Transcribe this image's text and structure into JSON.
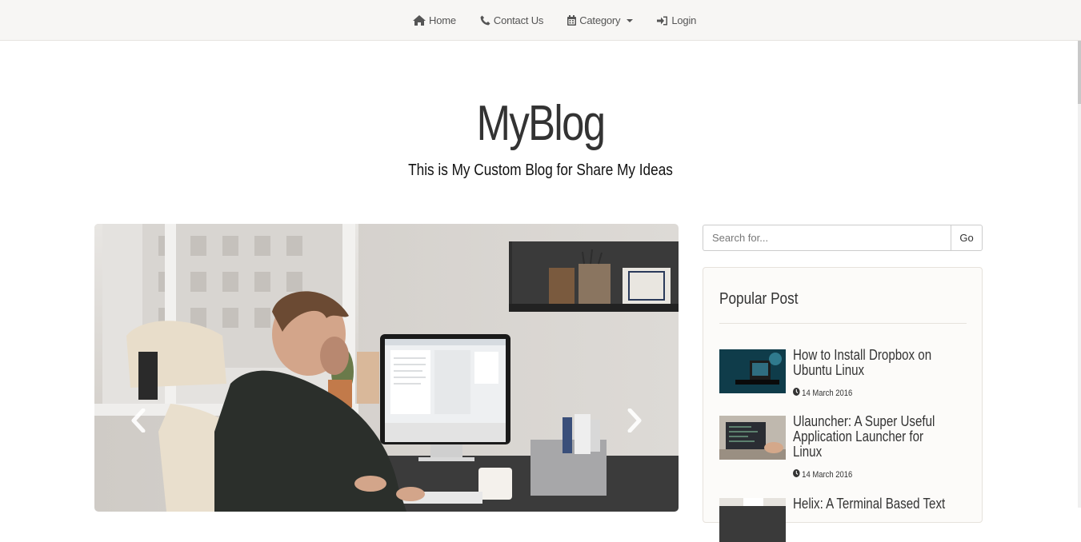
{
  "nav": {
    "items": [
      {
        "label": "Home",
        "icon": "home-icon"
      },
      {
        "label": "Contact Us",
        "icon": "phone-icon"
      },
      {
        "label": "Category",
        "icon": "calendar-icon",
        "dropdown": true
      },
      {
        "label": "Login",
        "icon": "sign-in-icon"
      }
    ]
  },
  "header": {
    "title": "MyBlog",
    "tagline": "This is My Custom Blog for Share My Ideas"
  },
  "carousel": {
    "image_subject": "man working at desktop computer by window",
    "prev_icon": "chevron-left-icon",
    "next_icon": "chevron-right-icon"
  },
  "search": {
    "placeholder": "Search for...",
    "button_label": "Go"
  },
  "popular": {
    "title": "Popular Post",
    "posts": [
      {
        "title": "How to Install Dropbox on Ubuntu Linux",
        "date": "14 March 2016",
        "thumb": "dark computer setup with blue light"
      },
      {
        "title": "Ulauncher: A Super Useful Application Launcher for Linux",
        "date": "14 March 2016",
        "thumb": "laptop with code on screen"
      },
      {
        "title": "Helix: A Terminal Based Text",
        "date": "",
        "thumb": "desk with laptop"
      }
    ]
  },
  "colors": {
    "navbar_bg": "#f7f6f4",
    "text_dark": "#333333",
    "card_bg": "#fcfbf9"
  }
}
